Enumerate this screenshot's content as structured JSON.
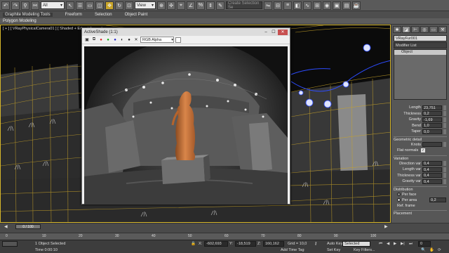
{
  "toolbar": {
    "filter_value": "All",
    "view_value": "View",
    "search_placeholder": "Create Selection Se"
  },
  "ribbon": {
    "tabs": [
      "Graphite Modeling Tools",
      "Freeform",
      "Selection",
      "Object Paint"
    ],
    "active_tab": "Graphite Modeling Tools",
    "sub_panel": "Polygon Modeling"
  },
  "viewport": {
    "label": "[ + ] [ VRayPhysicalCamera01 ] [ Shaded + Edged Faces ]"
  },
  "activeshade": {
    "title": "ActiveShade (1:1)",
    "channel": "RGB Alpha"
  },
  "command_panel": {
    "object_name": "VRayFur001",
    "modifier_list": "Modifier List",
    "stack_item": "Object",
    "params": [
      {
        "label": "Length",
        "value": "23,751"
      },
      {
        "label": "Thickness",
        "value": "0,2"
      },
      {
        "label": "Gravity",
        "value": "-1,69"
      },
      {
        "label": "Bend",
        "value": "1,0"
      },
      {
        "label": "Taper",
        "value": "0,0"
      }
    ],
    "geometric_detail": "Geometric detail",
    "knots_label": "Knots",
    "knots_value": "",
    "flat_normals": "Flat normals",
    "variation": "Variation",
    "variation_params": [
      {
        "label": "Direction var",
        "value": "0,4"
      },
      {
        "label": "Length var",
        "value": "0,4"
      },
      {
        "label": "Thickness var",
        "value": "0,4"
      },
      {
        "label": "Gravity var",
        "value": "0,4"
      }
    ],
    "distribution": "Distribution",
    "per_face": "Per face",
    "per_area": "Per area",
    "per_area_value": "0,2",
    "ref_frame": "Ref. frame",
    "placement": "Placement"
  },
  "timeline": {
    "slider": "0 / 100",
    "ticks": [
      "0",
      "10",
      "20",
      "30",
      "40",
      "50",
      "60",
      "70",
      "80",
      "90",
      "100"
    ]
  },
  "status": {
    "selected": "1 Object Selected",
    "time": "Time 0:00:10",
    "x_label": "X:",
    "x": "-602,693",
    "y_label": "Y:",
    "y": "-18,519",
    "z_label": "Z:",
    "z": "160,162",
    "grid": "Grid = 10,0",
    "auto_key": "Auto Key",
    "set_key": "Set Key",
    "key_mode": "Selected",
    "key_filters": "Key Filters...",
    "add_time_tag": "Add Time Tag",
    "frame": "0"
  },
  "colors": {
    "viewport_border": "#d6b62a",
    "statue": "#c8733a",
    "lights": "#2d4cff"
  }
}
